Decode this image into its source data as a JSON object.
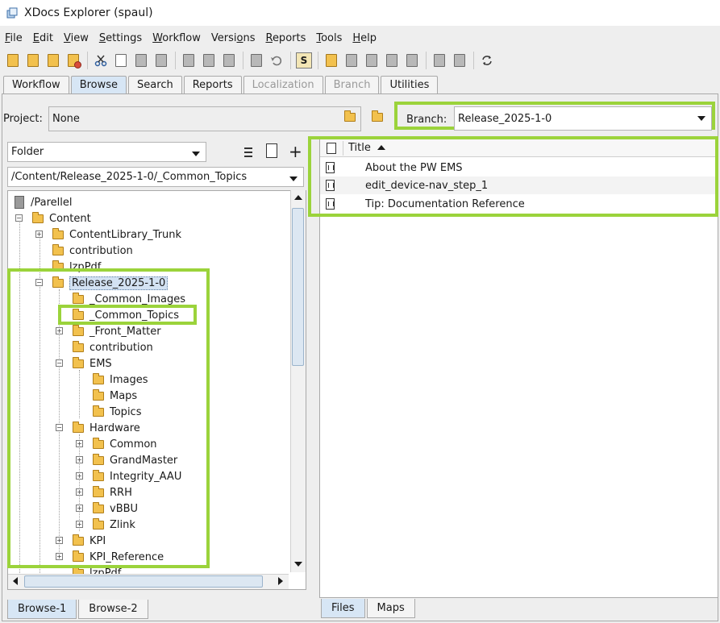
{
  "window": {
    "title": "XDocs Explorer (spaul)"
  },
  "menu": [
    {
      "pre": "",
      "key": "F",
      "post": "ile"
    },
    {
      "pre": "",
      "key": "E",
      "post": "dit"
    },
    {
      "pre": "",
      "key": "V",
      "post": "iew"
    },
    {
      "pre": "",
      "key": "S",
      "post": "ettings"
    },
    {
      "pre": "",
      "key": "W",
      "post": "orkflow"
    },
    {
      "pre": "Versi",
      "key": "o",
      "post": "ns"
    },
    {
      "pre": "",
      "key": "R",
      "post": "eports"
    },
    {
      "pre": "",
      "key": "T",
      "post": "ools"
    },
    {
      "pre": "",
      "key": "H",
      "post": "elp"
    }
  ],
  "toolbar": {
    "s_label": "S"
  },
  "tabs": [
    "Workflow",
    "Browse",
    "Search",
    "Reports",
    "Localization",
    "Branch",
    "Utilities"
  ],
  "project": {
    "label": "Project:",
    "value": "None"
  },
  "branch": {
    "label": "Branch:",
    "value": "Release_2025-1-0"
  },
  "folder_select": {
    "value": "Folder"
  },
  "path_select": {
    "value": "/Content/Release_2025-1-0/_Common_Topics"
  },
  "tree": [
    "/Parellel",
    "Content",
    "ContentLibrary_Trunk",
    "contribution",
    "lzpPdf",
    "Release_2025-1-0",
    "_Common_Images",
    "_Common_Topics",
    "_Front_Matter",
    "contribution",
    "EMS",
    "Images",
    "Maps",
    "Topics",
    "Hardware",
    "Common",
    "GrandMaster",
    "Integrity_AAU",
    "RRH",
    "vBBU",
    "Zlink",
    "KPI",
    "KPI_Reference",
    "lzpPdf"
  ],
  "browse_tabs": [
    "Browse-1",
    "Browse-2"
  ],
  "files": {
    "header": "Title",
    "rows": [
      "About the PW EMS",
      "edit_device-nav_step_1",
      "Tip: Documentation Reference"
    ]
  },
  "file_tabs": [
    "Files",
    "Maps"
  ],
  "colors": {
    "highlight": "#9bd33b",
    "selection": "#d3e2f3",
    "active_tab": "#d7e6f5"
  }
}
